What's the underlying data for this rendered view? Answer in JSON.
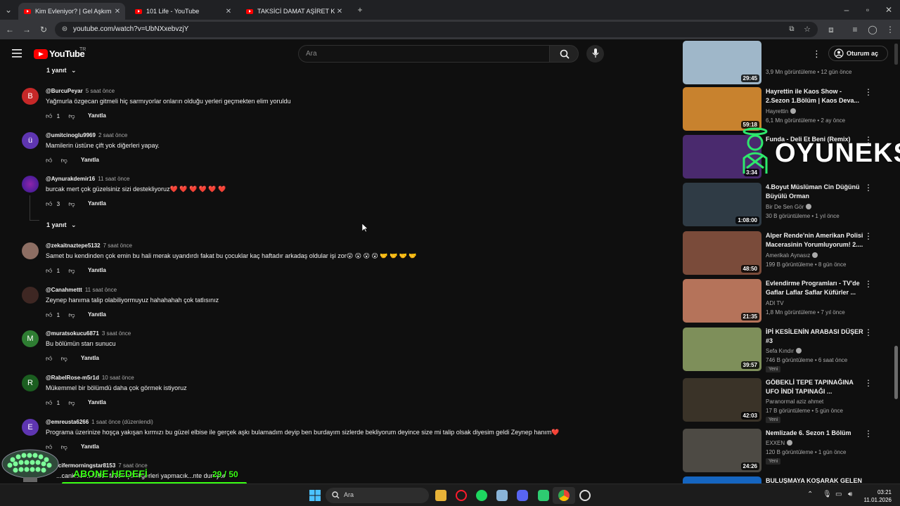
{
  "browser": {
    "tabs": [
      {
        "title": "Kim Evleniyor? | Gel Aşkım 11. B",
        "active": true
      },
      {
        "title": "101 Life - YouTube",
        "active": false
      },
      {
        "title": "TAKSİCİ DAMAT AŞİRET KIZINI",
        "active": false
      }
    ],
    "url": "youtube.com/watch?v=UbNXxebvzjY"
  },
  "youtube": {
    "logo_text": "YouTube",
    "country_code": "TR",
    "search_placeholder": "Ara",
    "signin_label": "Oturum aç"
  },
  "comments": [
    {
      "replies_label": "1 yanıt"
    },
    {
      "avatar_letter": "B",
      "avatar_color": "#c62828",
      "user": "@BurcuPeyar",
      "time": "5 saat önce",
      "text": "Yağmurla özgecan gitmeli hiç sarmıyorlar onların olduğu yerleri geçmekten elim yoruldu",
      "likes": "1",
      "reply_label": "Yanıtla"
    },
    {
      "avatar_letter": "ü",
      "avatar_color": "#5e35b1",
      "user": "@umitcinoglu9969",
      "time": "2 saat önce",
      "text": "Mamilerin üstüne çift yok diğerleri yapay.",
      "likes": "",
      "reply_label": "Yanıtla"
    },
    {
      "avatar_letter": "",
      "avatar_color": "#6a1b9a",
      "user": "@Aynurakdemir16",
      "time": "11 saat önce",
      "text": "burcak mert çok güzelsiniz sizi destekliyoruz❤️ ❤️ ❤️ ❤️ ❤️ ❤️",
      "likes": "3",
      "reply_label": "Yanıtla",
      "replies_label": "1 yanıt"
    },
    {
      "avatar_letter": "",
      "avatar_color": "#795548",
      "user": "@zekaitnaztepe5132",
      "time": "7 saat önce",
      "text": "Samet bu kendinden çok emin bu hali merak uyandırdı fakat bu çocuklar kaç haftadır arkadaş oldular işi zor😮 😮 😮 😮 🤝 🤝 🤝 🤝",
      "likes": "1",
      "reply_label": "Yanıtla"
    },
    {
      "avatar_letter": "",
      "avatar_color": "#3e2723",
      "user": "@Canahmettt",
      "time": "11 saat önce",
      "text": "Zeynep hanıma talip olabiliyormuyuz hahahahah çok tatlısınız",
      "likes": "1",
      "reply_label": "Yanıtla"
    },
    {
      "avatar_letter": "M",
      "avatar_color": "#2e7d32",
      "user": "@muratsokucu6871",
      "time": "3 saat önce",
      "text": "Bu bölümün starı sunucu",
      "likes": "",
      "reply_label": "Yanıtla"
    },
    {
      "avatar_letter": "R",
      "avatar_color": "#1b5e20",
      "user": "@RabelRose-m5r1d",
      "time": "10 saat önce",
      "text": "Mükemmel bir bölümdü daha çok görmek istiyoruz",
      "likes": "1",
      "reply_label": "Yanıtla"
    },
    {
      "avatar_letter": "E",
      "avatar_color": "#5e35b1",
      "user": "@emreusta6266",
      "time": "1 saat önce (düzenlendi)",
      "text": "Programa üzerinize hoşça yakışan kırmızı bu güzel elbise ile gerçek aşkı bulamadım deyip ben burdayım sizlerde bekliyorum deyince size mi talip olsak diyesim geldi Zeynep hanım❤️",
      "likes": "",
      "reply_label": "Yanıtla"
    },
    {
      "user": "@lucifermorningstar8153",
      "time": "7 saat önce",
      "text": "...cank...ac...hele...favori çift diğerleri yapmacık...nte duruyor"
    }
  ],
  "related": [
    {
      "title": "",
      "channel": "",
      "meta": "3,9 Mn görüntüleme • 12 gün önce",
      "duration": "29:45",
      "thumb_color": "#9fb7c9"
    },
    {
      "title": "Hayrettin ile Kaos Show - 2.Sezon 1.Bölüm | Kaos Deva...",
      "channel": "Hayrettin",
      "meta": "6,1 Mn görüntüleme • 2 ay önce",
      "duration": "59:18",
      "thumb_color": "#c8822e"
    },
    {
      "title": "Funda - Deli Et Beni (Remix)",
      "channel": "",
      "meta": "",
      "duration": "3:34",
      "thumb_color": "#4a2a6e"
    },
    {
      "title": "4.Boyut Müslüman Cin Düğünü Büyülü Orman",
      "channel": "Bir De Sen Gör",
      "meta": "30 B görüntüleme • 1 yıl önce",
      "duration": "1:08:00",
      "thumb_color": "#2f3b45"
    },
    {
      "title": "Alper Rende'nin Amerikan Polisi Macerasinin Yorumluyorum! 2....",
      "channel": "Amerikalı Aynasız",
      "meta": "199 B görüntüleme • 8 gün önce",
      "duration": "48:50",
      "thumb_color": "#7a4b3a"
    },
    {
      "title": "Evlendirme Programları - TV'de Gaflar Laflar Saflar Küfürler ...",
      "channel": "ADI TV",
      "meta": "1,8 Mn görüntüleme • 7 yıl önce",
      "duration": "21:35",
      "thumb_color": "#b5735a"
    },
    {
      "title": "İPİ KESİLENİN ARABASI DÜŞER #3",
      "channel": "Sefa Kındır",
      "meta": "746 B görüntüleme • 6 saat önce",
      "duration": "39:57",
      "thumb_color": "#7e8f5a",
      "badge": "Yeni"
    },
    {
      "title": "GÖBEKLİ TEPE TAPINAĞINA UFO İNDİ  TAPINAĞI ...",
      "channel": "Paranormal aziz ahmet",
      "meta": "17 B görüntüleme • 5 gün önce",
      "duration": "42:03",
      "thumb_color": "#3a3328",
      "badge": "Yeni"
    },
    {
      "title": "Nemlizade 6. Sezon 1 Bölüm",
      "channel": "EXXEN",
      "meta": "120 B görüntüleme • 1 gün önce",
      "duration": "24:26",
      "thumb_color": "#4d4a44",
      "badge": "Yeni"
    },
    {
      "title": "BULUŞMAYA KOŞARAK GELEN",
      "channel": "",
      "meta": "",
      "duration": "",
      "thumb_color": "#1565c0"
    }
  ],
  "overlay": {
    "watermark": "OYUNEKS",
    "sub_goal_label": "ABONE HEDEFİ",
    "sub_goal_count": "29 / 50",
    "sub_goal_progress": 0.58
  },
  "taskbar": {
    "search_placeholder": "Ara",
    "time": "03:21",
    "date": "11.01.2026"
  },
  "colors": {
    "accent": "#ff0000",
    "background": "#0f0f0f",
    "overlay_green": "#39ff14"
  }
}
